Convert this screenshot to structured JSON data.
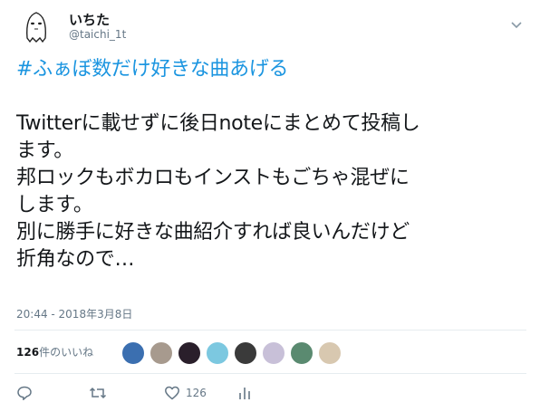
{
  "user": {
    "display_name": "いちた",
    "handle": "@taichi_1t"
  },
  "tweet": {
    "hashtag": "#ふぁぼ数だけ好きな曲あげる",
    "lines": [
      "Twitterに載せずに後日noteにまとめて投稿し",
      "ます。",
      "邦ロックもボカロもインストもごちゃ混ぜに",
      "します。",
      "別に勝手に好きな曲紹介すれば良いんだけど",
      "折角なので…"
    ],
    "timestamp": "20:44 - 2018年3月8日"
  },
  "stats": {
    "likes_count": "126",
    "likes_suffix": "件のいいね",
    "likers": [
      {
        "icon": "liker-avatar-1",
        "color": "#3b6fb0"
      },
      {
        "icon": "liker-avatar-2",
        "color": "#a79a8e"
      },
      {
        "icon": "liker-avatar-3",
        "color": "#2a1f2b"
      },
      {
        "icon": "liker-avatar-4",
        "color": "#7cc8e0"
      },
      {
        "icon": "liker-avatar-5",
        "color": "#3a3a3a"
      },
      {
        "icon": "liker-avatar-6",
        "color": "#c8c0d8"
      },
      {
        "icon": "liker-avatar-7",
        "color": "#5a8a70"
      },
      {
        "icon": "liker-avatar-8",
        "color": "#d8c8b0"
      }
    ]
  },
  "actions": {
    "reply_icon": "reply-icon",
    "retweet_icon": "retweet-icon",
    "like_icon": "heart-icon",
    "like_count": "126",
    "analytics_icon": "analytics-icon",
    "more_icon": "chevron-down-icon"
  },
  "colors": {
    "accent": "#1b95e0",
    "muted": "#657786",
    "text": "#14171a"
  }
}
